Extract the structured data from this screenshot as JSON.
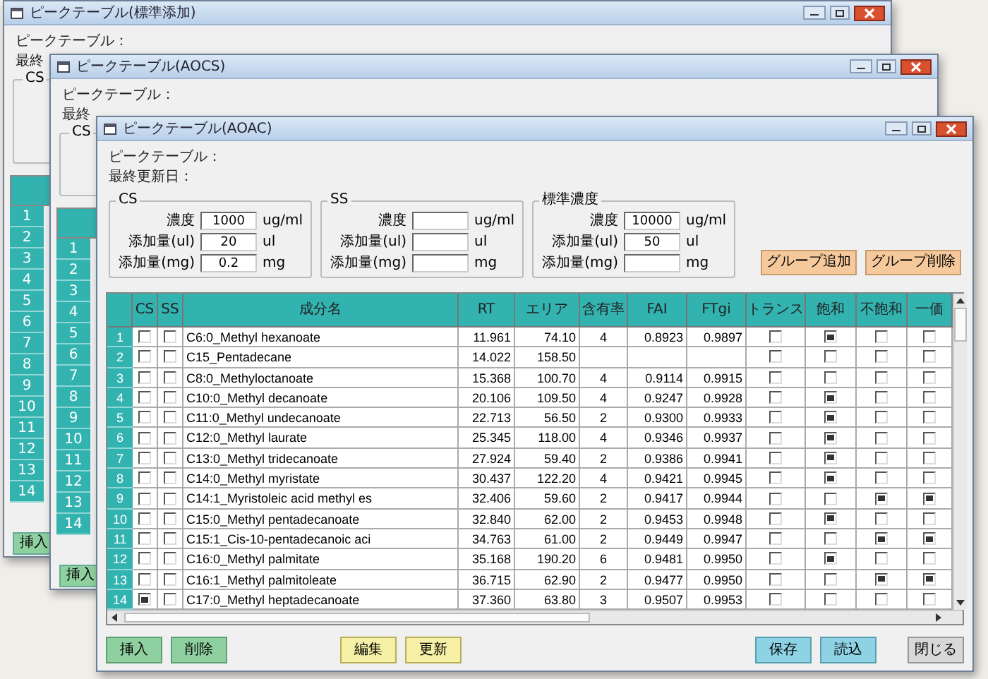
{
  "back_windows": [
    {
      "title": "ピークテーブル(標準添加)",
      "labels": [
        "ピークテーブル：",
        "最終"
      ],
      "group_label": "CS",
      "row_numbers": [
        "1",
        "2",
        "3",
        "4",
        "5",
        "6",
        "7",
        "8",
        "9",
        "10",
        "11",
        "12",
        "13",
        "14"
      ],
      "insert_button": "挿入"
    },
    {
      "title": "ピークテーブル(AOCS)",
      "labels": [
        "ピークテーブル：",
        "最終"
      ],
      "group_label": "CS",
      "row_numbers": [
        "1",
        "2",
        "3",
        "4",
        "5",
        "6",
        "7",
        "8",
        "9",
        "10",
        "11",
        "12",
        "13",
        "14"
      ],
      "insert_button": "挿入"
    }
  ],
  "window": {
    "title": "ピークテーブル(AOAC)",
    "labels": [
      "ピークテーブル：",
      "最終更新日："
    ],
    "groups": [
      {
        "label": "CS",
        "fields": [
          {
            "label": "濃度",
            "value": "1000",
            "unit": "ug/ml"
          },
          {
            "label": "添加量(ul)",
            "value": "20",
            "unit": "ul"
          },
          {
            "label": "添加量(mg)",
            "value": "0.2",
            "unit": "mg"
          }
        ]
      },
      {
        "label": "SS",
        "fields": [
          {
            "label": "濃度",
            "unit": "ug/ml"
          },
          {
            "label": "添加量(ul)",
            "unit": "ul"
          },
          {
            "label": "添加量(mg)",
            "unit": "mg"
          }
        ]
      },
      {
        "label": "標準濃度",
        "fields": [
          {
            "label": "濃度",
            "value": "10000",
            "unit": "ug/ml"
          },
          {
            "label": "添加量(ul)",
            "value": "50",
            "unit": "ul"
          },
          {
            "label": "添加量(mg)",
            "unit": "mg"
          }
        ]
      }
    ],
    "group_buttons": [
      "グループ追加",
      "グループ削除"
    ],
    "columns": [
      {
        "label": "CS",
        "kind": "check"
      },
      {
        "label": "SS",
        "kind": "check"
      },
      {
        "label": "成分名",
        "kind": "text"
      },
      {
        "label": "RT",
        "kind": "number"
      },
      {
        "label": "エリア",
        "kind": "number"
      },
      {
        "label": "含有率",
        "kind": "center"
      },
      {
        "label": "FAI",
        "kind": "number"
      },
      {
        "label": "FTgi",
        "kind": "number"
      },
      {
        "label": "トランス",
        "kind": "check"
      },
      {
        "label": "飽和",
        "kind": "check"
      },
      {
        "label": "不飽和",
        "kind": "check"
      },
      {
        "label": "一価",
        "kind": "check"
      }
    ],
    "rows": [
      {
        "num": "1",
        "cells": [
          false,
          false,
          "C6:0_Methyl hexanoate",
          "11.961",
          "74.10",
          "4",
          "0.8923",
          "0.9897",
          false,
          true,
          false,
          false
        ]
      },
      {
        "num": "2",
        "cells": [
          false,
          false,
          "C15_Pentadecane",
          "14.022",
          "158.50",
          "",
          "",
          "",
          false,
          false,
          false,
          false
        ]
      },
      {
        "num": "3",
        "cells": [
          false,
          false,
          "C8:0_Methyloctanoate",
          "15.368",
          "100.70",
          "4",
          "0.9114",
          "0.9915",
          false,
          false,
          false,
          false
        ]
      },
      {
        "num": "4",
        "cells": [
          false,
          false,
          "C10:0_Methyl decanoate",
          "20.106",
          "109.50",
          "4",
          "0.9247",
          "0.9928",
          false,
          true,
          false,
          false
        ]
      },
      {
        "num": "5",
        "cells": [
          false,
          false,
          "C11:0_Methyl undecanoate",
          "22.713",
          "56.50",
          "2",
          "0.9300",
          "0.9933",
          false,
          true,
          false,
          false
        ]
      },
      {
        "num": "6",
        "cells": [
          false,
          false,
          "C12:0_Methyl laurate",
          "25.345",
          "118.00",
          "4",
          "0.9346",
          "0.9937",
          false,
          true,
          false,
          false
        ]
      },
      {
        "num": "7",
        "cells": [
          false,
          false,
          "C13:0_Methyl tridecanoate",
          "27.924",
          "59.40",
          "2",
          "0.9386",
          "0.9941",
          false,
          true,
          false,
          false
        ]
      },
      {
        "num": "8",
        "cells": [
          false,
          false,
          "C14:0_Methyl myristate",
          "30.437",
          "122.20",
          "4",
          "0.9421",
          "0.9945",
          false,
          true,
          false,
          false
        ]
      },
      {
        "num": "9",
        "cells": [
          false,
          false,
          "C14:1_Myristoleic acid methyl es",
          "32.406",
          "59.60",
          "2",
          "0.9417",
          "0.9944",
          false,
          false,
          true,
          true
        ]
      },
      {
        "num": "10",
        "cells": [
          false,
          false,
          "C15:0_Methyl pentadecanoate",
          "32.840",
          "62.00",
          "2",
          "0.9453",
          "0.9948",
          false,
          true,
          false,
          false
        ]
      },
      {
        "num": "11",
        "cells": [
          false,
          false,
          "C15:1_Cis-10-pentadecanoic aci",
          "34.763",
          "61.00",
          "2",
          "0.9449",
          "0.9947",
          false,
          false,
          true,
          true
        ]
      },
      {
        "num": "12",
        "cells": [
          false,
          false,
          "C16:0_Methyl palmitate",
          "35.168",
          "190.20",
          "6",
          "0.9481",
          "0.9950",
          false,
          true,
          false,
          false
        ]
      },
      {
        "num": "13",
        "cells": [
          false,
          false,
          "C16:1_Methyl palmitoleate",
          "36.715",
          "62.90",
          "2",
          "0.9477",
          "0.9950",
          false,
          false,
          true,
          true
        ]
      },
      {
        "num": "14",
        "cells": [
          true,
          false,
          "C17:0_Methyl heptadecanoate",
          "37.360",
          "63.80",
          "3",
          "0.9507",
          "0.9953",
          false,
          false,
          false,
          false
        ]
      }
    ],
    "buttons": [
      {
        "label": "挿入",
        "kind": "row"
      },
      {
        "label": "削除",
        "kind": "row"
      },
      {
        "label": "編集",
        "kind": "record"
      },
      {
        "label": "更新",
        "kind": "record"
      },
      {
        "label": "保存",
        "kind": "file"
      },
      {
        "label": "読込",
        "kind": "file"
      },
      {
        "label": "閉じる",
        "kind": "window"
      }
    ]
  }
}
